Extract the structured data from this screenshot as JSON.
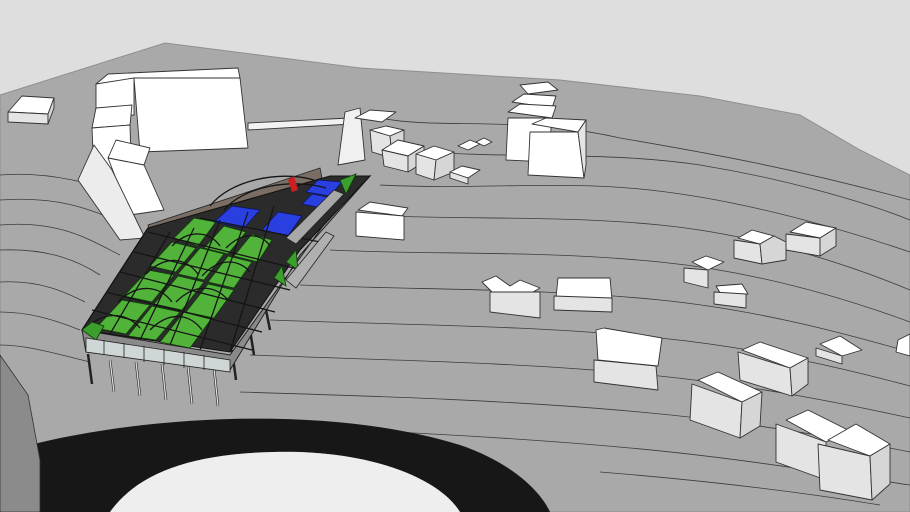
{
  "scene": {
    "colors": {
      "sky": "#dedede",
      "terrain": "#a9a9a9",
      "terrain_edge": "#8f8f8f",
      "contour": "#3c3c3c",
      "building_top": "#ffffff",
      "building_side": "#e4e4e4",
      "building_outline": "#333333",
      "road": "#171717",
      "court_green": "#52b33a",
      "court_blue": "#2a3fe0",
      "frame": "#1d1d1d",
      "deck": "#8a8a8a",
      "accent_red": "#cc1f1f"
    }
  }
}
